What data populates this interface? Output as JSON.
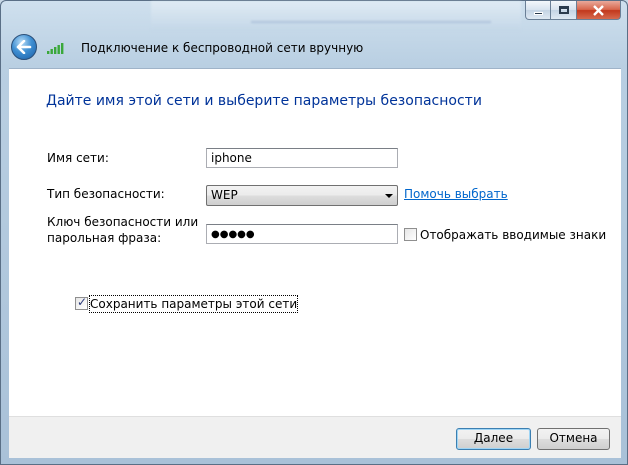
{
  "window": {
    "title": "Подключение к беспроводной сети вручную"
  },
  "page": {
    "heading": "Дайте имя этой сети и выберите параметры безопасности"
  },
  "form": {
    "network_name": {
      "label": "Имя сети:",
      "value": "iphone"
    },
    "security_type": {
      "label": "Тип безопасности:",
      "value": "WEP",
      "help_link": "Помочь выбрать"
    },
    "security_key": {
      "label_line1": "Ключ безопасности или",
      "label_line2": "парольная фраза:",
      "masked_value": "●●●●●",
      "show_chars_label": "Отображать вводимые знаки",
      "show_chars_checked": false
    },
    "save_settings": {
      "label": "Сохранить параметры этой сети",
      "checked": true
    }
  },
  "footer": {
    "next_label": "Далее",
    "cancel_label": "Отмена"
  },
  "icons": {
    "back": "back-arrow-icon",
    "signal": "wireless-signal-icon",
    "minimize": "minimize-icon",
    "maximize": "maximize-icon",
    "close": "close-icon"
  },
  "colors": {
    "heading": "#003399",
    "link": "#0066cc",
    "signal_bars": "#3aa83a"
  }
}
